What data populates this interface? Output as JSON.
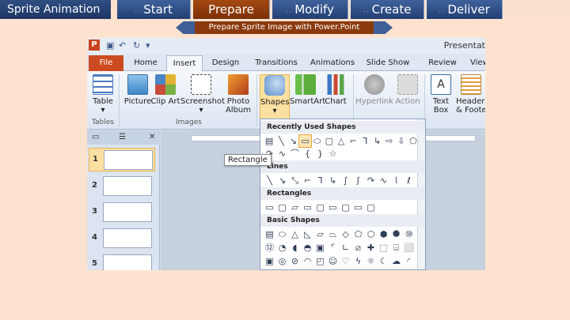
{
  "nav": {
    "title": "Sprite Animation",
    "tabs": [
      {
        "label": "Start"
      },
      {
        "label": "Prepare"
      },
      {
        "label": "Modify"
      },
      {
        "label": "Create"
      },
      {
        "label": "Deliver"
      }
    ]
  },
  "banner": {
    "text": "Prepare Sprite Image with Power.Point"
  },
  "window": {
    "title": "Presentat"
  },
  "ribbon_tabs": [
    "File",
    "Home",
    "Insert",
    "Design",
    "Transitions",
    "Animations",
    "Slide Show",
    "Review",
    "View"
  ],
  "ribbon": {
    "buttons": {
      "table": "Table",
      "picture": "Picture",
      "clip_art": "Clip Art",
      "screenshot": "Screenshot",
      "photo_album": "Photo Album",
      "shapes": "Shapes",
      "smartart": "SmartArt",
      "chart": "Chart",
      "hyperlink": "Hyperlink",
      "action": "Action",
      "text_box": "Text Box",
      "header_footer": "Header & Foote"
    },
    "groups": {
      "tables": "Tables",
      "images": "Images"
    }
  },
  "slides": [
    "1",
    "2",
    "3",
    "4",
    "5"
  ],
  "shapes_menu": {
    "recent": "Recently Used Shapes",
    "lines": "Lines",
    "rectangles": "Rectangles",
    "basic": "Basic Shapes",
    "tooltip": "Rectangle"
  },
  "colors": {
    "nav_bg": "#233f73",
    "active_tab": "#7a2f06",
    "banner_bg": "#8b3a0e",
    "highlight": "#fbe0a2"
  }
}
